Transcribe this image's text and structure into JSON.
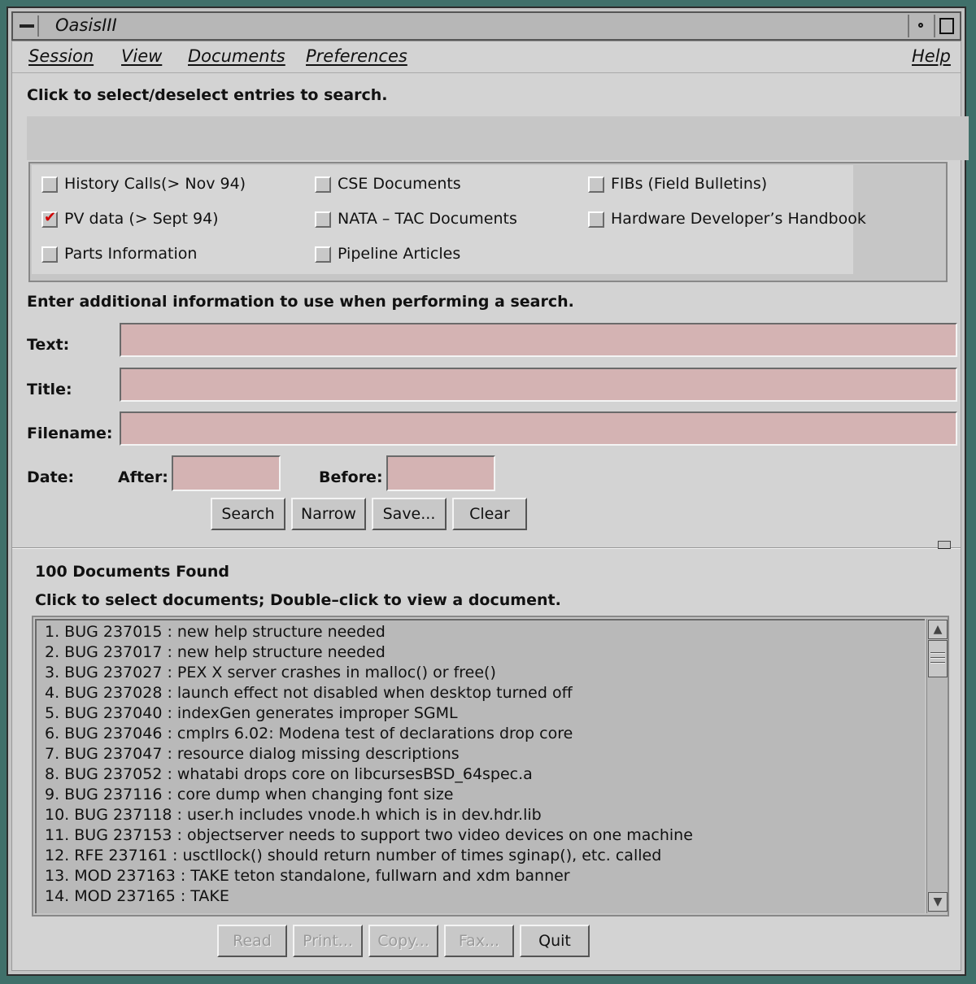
{
  "window": {
    "title": "OasisIII"
  },
  "menubar": {
    "session": "Session",
    "view": "View",
    "documents": "Documents",
    "preferences": "Preferences",
    "help": "Help"
  },
  "entries": {
    "prompt": "Click to select/deselect entries to search.",
    "items": [
      {
        "label": "History Calls(> Nov 94)",
        "checked": false
      },
      {
        "label": "CSE Documents",
        "checked": false
      },
      {
        "label": "FIBs (Field Bulletins)",
        "checked": false
      },
      {
        "label": "PV data (> Sept 94)",
        "checked": true
      },
      {
        "label": "NATA – TAC Documents",
        "checked": false
      },
      {
        "label": "Hardware Developer’s Handbook",
        "checked": false
      },
      {
        "label": "Parts Information",
        "checked": false
      },
      {
        "label": "Pipeline Articles",
        "checked": false
      }
    ]
  },
  "search_form": {
    "prompt": "Enter additional information to use when performing a search.",
    "text_label": "Text:",
    "title_label": "Title:",
    "filename_label": "Filename:",
    "date_label": "Date:",
    "after_label": "After:",
    "before_label": "Before:",
    "text_value": "",
    "title_value": "",
    "filename_value": "",
    "after_value": "",
    "before_value": ""
  },
  "actions": {
    "search": "Search",
    "narrow": "Narrow",
    "save": "Save...",
    "clear": "Clear"
  },
  "results": {
    "count_text": "100 Documents Found",
    "instruction": "Click to select documents; Double–click to view a document.",
    "documents": [
      "1.  BUG 237015 : new help structure needed",
      "2.  BUG 237017 : new help structure needed",
      "3.  BUG 237027 : PEX X server crashes in malloc() or free()",
      "4.  BUG 237028 : launch effect not disabled when desktop turned off",
      "5.  BUG 237040 : indexGen generates improper SGML",
      "6.  BUG 237046 : cmplrs 6.02: Modena test of declarations drop core",
      "7.  BUG 237047 : resource dialog missing descriptions",
      "8.  BUG 237052 : whatabi drops core on libcursesBSD_64spec.a",
      "9.  BUG 237116 : core dump when changing font size",
      "10.  BUG 237118 : user.h includes vnode.h which is in dev.hdr.lib",
      "11.  BUG 237153 : objectserver needs to support two video devices on one machine",
      "12.  RFE 237161 : usctllock() should return number of times sginap(), etc. called",
      "13.  MOD 237163 : TAKE teton standalone, fullwarn and xdm banner",
      "14.  MOD 237165 : TAKE"
    ]
  },
  "bottom_buttons": {
    "read": "Read",
    "print": "Print...",
    "copy": "Copy...",
    "fax": "Fax...",
    "quit": "Quit"
  },
  "colors": {
    "desktop": "#40706a",
    "field_fill": "#d4b3b3",
    "check_mark": "#d00000"
  }
}
